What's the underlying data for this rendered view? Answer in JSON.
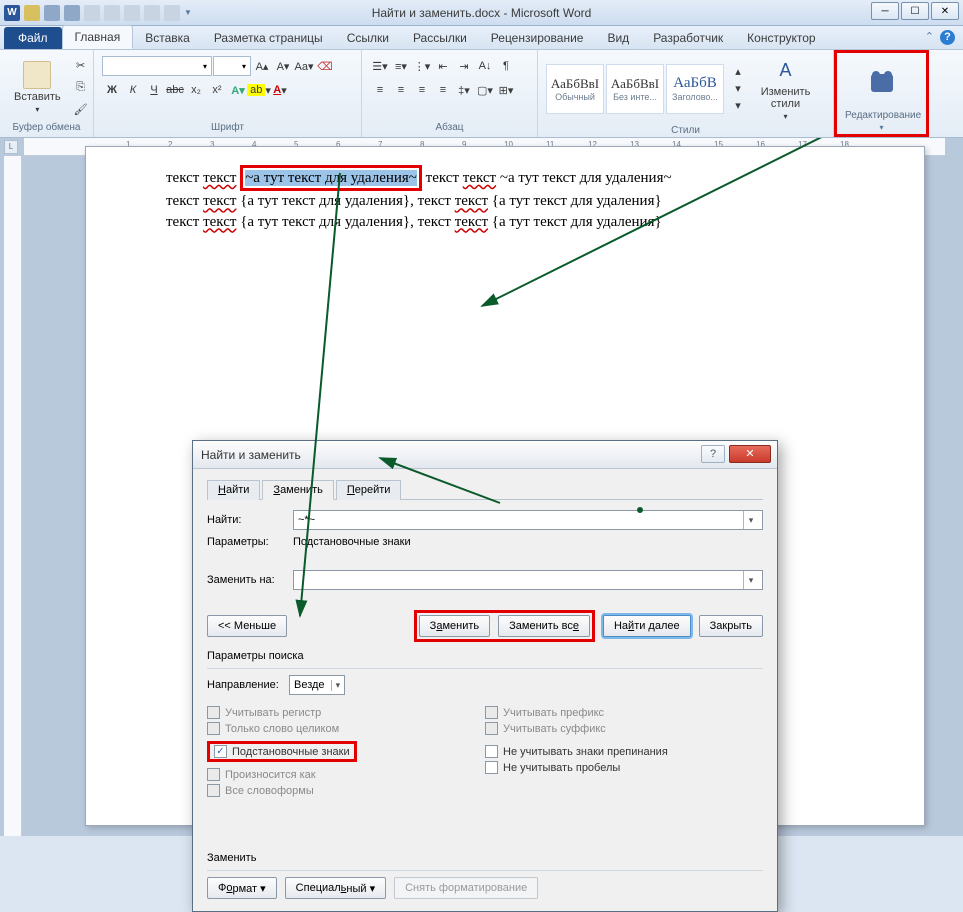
{
  "title": "Найти и заменить.docx - Microsoft Word",
  "file_tab": "Файл",
  "tabs": [
    "Главная",
    "Вставка",
    "Разметка страницы",
    "Ссылки",
    "Рассылки",
    "Рецензирование",
    "Вид",
    "Разработчик",
    "Конструктор"
  ],
  "ribbon": {
    "clipboard": {
      "paste": "Вставить",
      "label": "Буфер обмена"
    },
    "font": {
      "label": "Шрифт",
      "font_name": "",
      "font_size": "",
      "buttons": {
        "bold": "Ж",
        "italic": "К",
        "underline": "Ч",
        "strike": "abc",
        "sub": "x₂",
        "sup": "x²"
      }
    },
    "paragraph": {
      "label": "Абзац"
    },
    "styles": {
      "label": "Стили",
      "items": [
        {
          "sample": "АаБбВвІ",
          "name": "Обычный"
        },
        {
          "sample": "АаБбВвІ",
          "name": "Без инте..."
        },
        {
          "sample": "АаБбВ",
          "name": "Заголово..."
        }
      ],
      "change": "Изменить стили"
    },
    "editing": {
      "label": "Редактирование"
    }
  },
  "document": {
    "line1_pre": "текст ",
    "line1_wavy": "текст",
    "line1_hl": "~а тут текст для удаления~",
    "line1_post1": " текст ",
    "line1_post2": "текст",
    "line1_post3": " ~а тут текст для удаления~",
    "line2_a": "текст ",
    "line2_b": "текст",
    "line2_c": " {а тут текст для удаления}, текст ",
    "line2_d": "текст",
    "line2_e": " {а тут текст для удаления}",
    "line3_a": "текст ",
    "line3_b": "текст",
    "line3_c": " {а тут текст для удаления}, текст ",
    "line3_d": "текст",
    "line3_e": " {а тут текст для удаления}"
  },
  "dialog": {
    "title": "Найти и заменить",
    "tabs": {
      "find": "Найти",
      "replace": "Заменить",
      "goto": "Перейти"
    },
    "find_label": "Найти:",
    "find_value": "~*~",
    "params_label": "Параметры:",
    "params_value": "Подстановочные знаки",
    "replace_label": "Заменить на:",
    "replace_value": "",
    "btn_less": "<< Меньше",
    "btn_replace": "Заменить",
    "btn_replace_all": "Заменить все",
    "btn_find_next": "Найти далее",
    "btn_close": "Закрыть",
    "search_params": "Параметры поиска",
    "direction_label": "Направление:",
    "direction_value": "Везде",
    "chk_case": "Учитывать регистр",
    "chk_whole": "Только слово целиком",
    "chk_wildcards": "Подстановочные знаки",
    "chk_sounds": "Произносится как",
    "chk_forms": "Все словоформы",
    "chk_prefix": "Учитывать префикс",
    "chk_suffix": "Учитывать суффикс",
    "chk_punct": "Не учитывать знаки препинания",
    "chk_spaces": "Не учитывать пробелы",
    "section_replace": "Заменить",
    "btn_format": "Формат",
    "btn_special": "Специальный",
    "btn_noformat": "Снять форматирование"
  }
}
